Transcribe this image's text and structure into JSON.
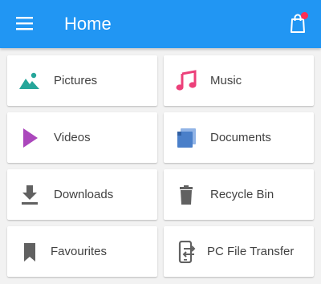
{
  "appbar": {
    "title": "Home",
    "menu_icon": "hamburger-menu-icon",
    "cart_icon": "shopping-bag-icon",
    "badge_color": "#ff2d55",
    "bar_color": "#2196f3"
  },
  "categories": [
    {
      "label": "Pictures",
      "icon": "image-icon",
      "color": "#26a69a"
    },
    {
      "label": "Music",
      "icon": "music-note-icon",
      "color": "#ec407a"
    },
    {
      "label": "Videos",
      "icon": "play-icon",
      "color": "#ab47bc"
    },
    {
      "label": "Documents",
      "icon": "documents-icon",
      "color": "#4a7fc9"
    },
    {
      "label": "Downloads",
      "icon": "download-icon",
      "color": "#616161"
    },
    {
      "label": "Recycle Bin",
      "icon": "trash-icon",
      "color": "#616161"
    },
    {
      "label": "Favourites",
      "icon": "bookmark-icon",
      "color": "#616161"
    },
    {
      "label": "PC File Transfer",
      "icon": "pc-transfer-icon",
      "color": "#616161"
    }
  ]
}
